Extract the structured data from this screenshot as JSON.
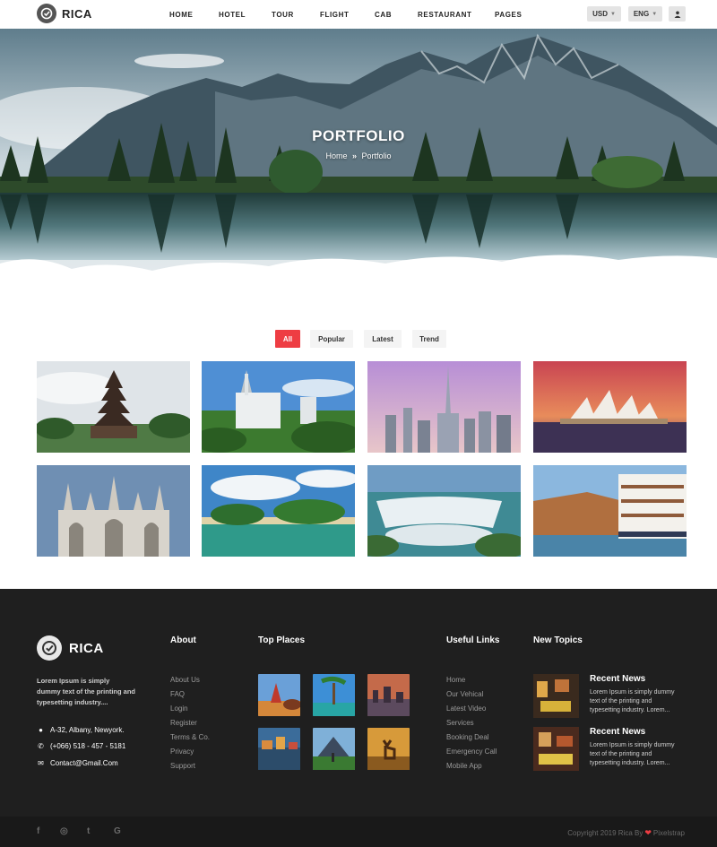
{
  "header": {
    "logo_text": "RICA",
    "nav": [
      "HOME",
      "HOTEL",
      "TOUR",
      "FLIGHT",
      "CAB",
      "RESTAURANT",
      "PAGES"
    ],
    "currency": "USD",
    "language": "ENG",
    "user_icon": "user-icon"
  },
  "hero": {
    "title": "PORTFOLIO",
    "breadcrumb_home": "Home",
    "breadcrumb_sep": "»",
    "breadcrumb_current": "Portfolio"
  },
  "filters": [
    "All",
    "Popular",
    "Latest",
    "Trend"
  ],
  "active_filter": "All",
  "gallery": [
    {
      "name": "bali-temple-image"
    },
    {
      "name": "castle-image"
    },
    {
      "name": "dubai-skyline-image"
    },
    {
      "name": "sydney-opera-image"
    },
    {
      "name": "cathedral-image"
    },
    {
      "name": "tropical-beach-image"
    },
    {
      "name": "waterfall-image"
    },
    {
      "name": "river-cruise-image"
    }
  ],
  "footer": {
    "logo_text": "RICA",
    "description": "Lorem Ipsum is simply dummy text of the printing and typesetting industry....",
    "address": "A-32, Albany, Newyork.",
    "phone": "(+066) 518 - 457 - 5181",
    "email": "Contact@Gmail.Com",
    "about_heading": "About",
    "about_links": [
      "About Us",
      "FAQ",
      "Login",
      "Register",
      "Terms & Co.",
      "Privacy",
      "Support"
    ],
    "places_heading": "Top Places",
    "useful_heading": "Useful Links",
    "useful_links": [
      "Home",
      "Our Vehical",
      "Latest Video",
      "Services",
      "Booking Deal",
      "Emergency Call",
      "Mobile App"
    ],
    "topics_heading": "New Topics",
    "news": [
      {
        "title": "Recent News",
        "text": "Lorem Ipsum is simply dummy text of the printing and typesetting industry. Lorem..."
      },
      {
        "title": "Recent News",
        "text": "Lorem Ipsum is simply dummy text of the printing and typesetting industry. Lorem..."
      }
    ]
  },
  "bottom": {
    "social": [
      "f",
      "◎",
      "t",
      "G"
    ],
    "copyright": "Copyright 2019 Rica By",
    "brand": "Pixelstrap"
  },
  "colors": {
    "accent": "#ee3d43",
    "footer_bg": "#1f1f1f",
    "bottom_bg": "#191919"
  }
}
